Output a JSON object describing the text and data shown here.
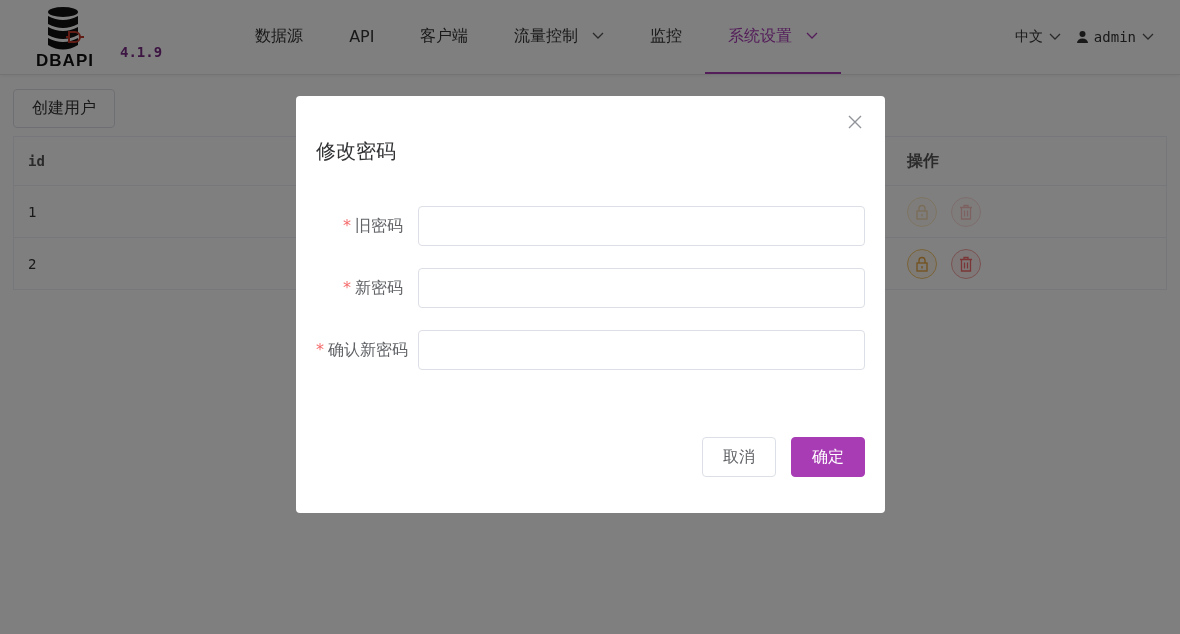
{
  "header": {
    "logo_text": "DBAPI",
    "version": "4.1.9",
    "nav": [
      {
        "label": "数据源",
        "selected": false,
        "dropdown": false
      },
      {
        "label": "API",
        "selected": false,
        "dropdown": false
      },
      {
        "label": "客户端",
        "selected": false,
        "dropdown": false
      },
      {
        "label": "流量控制",
        "selected": false,
        "dropdown": true
      },
      {
        "label": "监控",
        "selected": false,
        "dropdown": false
      },
      {
        "label": "系统设置",
        "selected": true,
        "dropdown": true
      }
    ],
    "language": "中文",
    "user": "admin"
  },
  "create_button": "创建用户",
  "table": {
    "columns": [
      "id",
      "操作"
    ],
    "rows": [
      {
        "id": "1",
        "actions_disabled": true
      },
      {
        "id": "2",
        "actions_disabled": false
      }
    ]
  },
  "dialog": {
    "title": "修改密码",
    "fields": [
      {
        "label": "旧密码",
        "required_mark": "*"
      },
      {
        "label": "新密码",
        "required_mark": "*"
      },
      {
        "label": "确认新密码",
        "required_mark": "*"
      }
    ],
    "cancel": "取消",
    "confirm": "确定"
  }
}
